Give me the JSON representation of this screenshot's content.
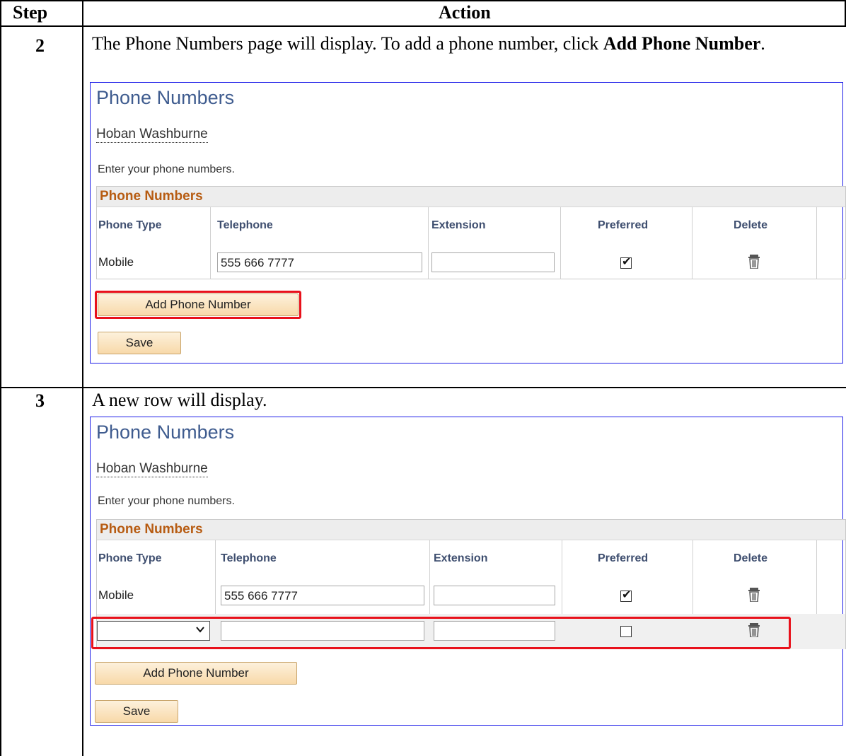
{
  "header": {
    "step": "Step",
    "action": "Action"
  },
  "step2": {
    "number": "2",
    "text_before": "The Phone Numbers page will display.  To add a phone number, click ",
    "text_bold": "Add Phone Number",
    "text_after": "."
  },
  "step3": {
    "number": "3",
    "text": "A new row will display."
  },
  "panel": {
    "title": "Phone Numbers",
    "name": "Hoban Washburne",
    "instruction": "Enter your phone numbers.",
    "grid_title": "Phone Numbers",
    "columns": [
      "Phone Type",
      "Telephone",
      "Extension",
      "Preferred",
      "Delete"
    ],
    "row1": {
      "phone_type": "Mobile",
      "telephone": "555 666 7777",
      "extension": "",
      "preferred": true
    },
    "add_button": "Add Phone Number",
    "save_button": "Save"
  },
  "colors": {
    "highlight": "#e8111b",
    "title": "#3f5c8f",
    "grid_title": "#b75c12"
  },
  "icons": [
    "trash-icon",
    "checkmark-icon",
    "chevron-down-icon"
  ]
}
